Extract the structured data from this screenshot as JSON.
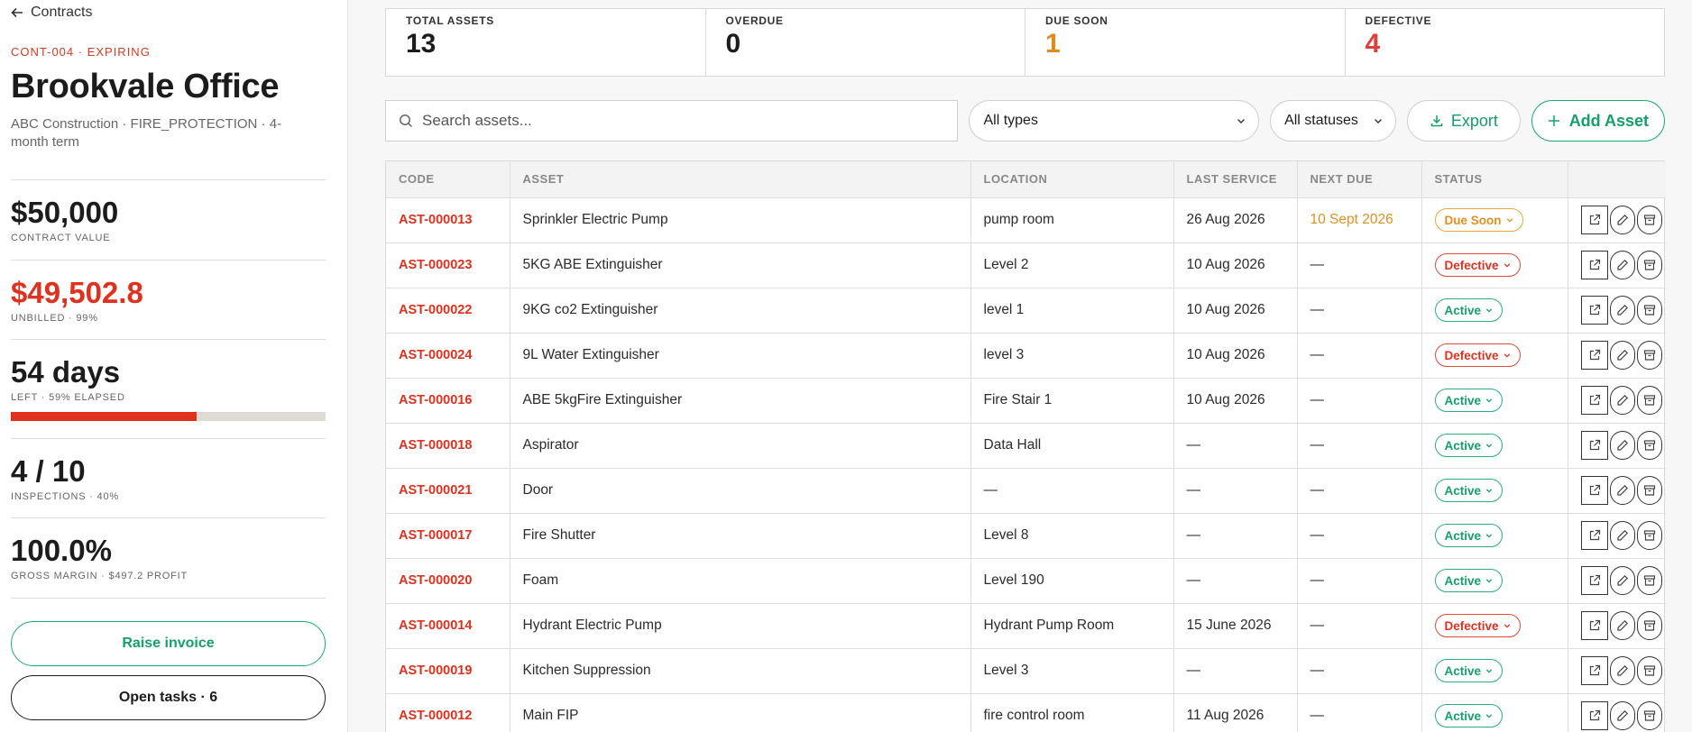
{
  "sidebar": {
    "back_label": "Contracts",
    "code_line": "CONT-004 · EXPIRING",
    "title": "Brookvale Office",
    "subtitle": "ABC Construction · FIRE_PROTECTION · 4-month term",
    "contract_value": "$50,000",
    "contract_value_label": "CONTRACT VALUE",
    "unbilled": "$49,502.8",
    "unbilled_label": "UNBILLED · 99%",
    "days_left": "54 days",
    "days_left_label": "LEFT · 59% ELAPSED",
    "elapsed_fraction": 0.59,
    "inspections": "4 / 10",
    "inspections_label": "INSPECTIONS · 40%",
    "margin": "100.0%",
    "margin_label": "GROSS MARGIN · $497.2 PROFIT",
    "raise_invoice_label": "Raise invoice",
    "open_tasks_label": "Open tasks · 6"
  },
  "summary": [
    {
      "label": "TOTAL ASSETS",
      "value": "13",
      "tone": "default"
    },
    {
      "label": "OVERDUE",
      "value": "0",
      "tone": "default"
    },
    {
      "label": "DUE SOON",
      "value": "1",
      "tone": "orange"
    },
    {
      "label": "DEFECTIVE",
      "value": "4",
      "tone": "red"
    }
  ],
  "toolbar": {
    "search_placeholder": "Search assets...",
    "type_filter": "All types",
    "status_filter": "All statuses",
    "export_label": "Export",
    "add_label": "Add Asset"
  },
  "table": {
    "columns": [
      "CODE",
      "ASSET",
      "LOCATION",
      "LAST SERVICE",
      "NEXT DUE",
      "STATUS",
      ""
    ],
    "rows": [
      {
        "code": "AST-000013",
        "asset": "Sprinkler Electric Pump",
        "location": "pump room",
        "last": "26 Aug 2026",
        "next": "10 Sept 2026",
        "next_warn": true,
        "status": "Due Soon",
        "status_type": "due"
      },
      {
        "code": "AST-000023",
        "asset": "5KG ABE Extinguisher",
        "location": "Level 2",
        "last": "10 Aug 2026",
        "next": "—",
        "next_warn": false,
        "status": "Defective",
        "status_type": "defective"
      },
      {
        "code": "AST-000022",
        "asset": "9KG co2 Extinguisher",
        "location": "level 1",
        "last": "10 Aug 2026",
        "next": "—",
        "next_warn": false,
        "status": "Active",
        "status_type": "active"
      },
      {
        "code": "AST-000024",
        "asset": "9L Water Extinguisher",
        "location": "level 3",
        "last": "10 Aug 2026",
        "next": "—",
        "next_warn": false,
        "status": "Defective",
        "status_type": "defective"
      },
      {
        "code": "AST-000016",
        "asset": "ABE 5kgFire Extinguisher",
        "location": "Fire Stair 1",
        "last": "10 Aug 2026",
        "next": "—",
        "next_warn": false,
        "status": "Active",
        "status_type": "active"
      },
      {
        "code": "AST-000018",
        "asset": "Aspirator",
        "location": "Data Hall",
        "last": "—",
        "next": "—",
        "next_warn": false,
        "status": "Active",
        "status_type": "active"
      },
      {
        "code": "AST-000021",
        "asset": "Door",
        "location": "—",
        "last": "—",
        "next": "—",
        "next_warn": false,
        "status": "Active",
        "status_type": "active"
      },
      {
        "code": "AST-000017",
        "asset": "Fire Shutter",
        "location": "Level 8",
        "last": "—",
        "next": "—",
        "next_warn": false,
        "status": "Active",
        "status_type": "active"
      },
      {
        "code": "AST-000020",
        "asset": "Foam",
        "location": "Level 190",
        "last": "—",
        "next": "—",
        "next_warn": false,
        "status": "Active",
        "status_type": "active"
      },
      {
        "code": "AST-000014",
        "asset": "Hydrant Electric Pump",
        "location": "Hydrant Pump Room",
        "last": "15 June 2026",
        "next": "—",
        "next_warn": false,
        "status": "Defective",
        "status_type": "defective"
      },
      {
        "code": "AST-000019",
        "asset": "Kitchen Suppression",
        "location": "Level 3",
        "last": "—",
        "next": "—",
        "next_warn": false,
        "status": "Active",
        "status_type": "active"
      },
      {
        "code": "AST-000012",
        "asset": "Main FIP",
        "location": "fire control room",
        "last": "11 Aug 2026",
        "next": "—",
        "next_warn": false,
        "status": "Active",
        "status_type": "active"
      }
    ]
  },
  "icons": {
    "back": "arrow-left-icon",
    "search": "search-icon",
    "chevron": "chevron-down-icon",
    "export": "download-icon",
    "add": "plus-icon",
    "open": "external-link-icon",
    "edit": "pencil-icon",
    "archive": "archive-icon"
  },
  "colors": {
    "accent_green": "#13a06a",
    "danger_red": "#e0301e",
    "warning_orange": "#e0901e"
  }
}
